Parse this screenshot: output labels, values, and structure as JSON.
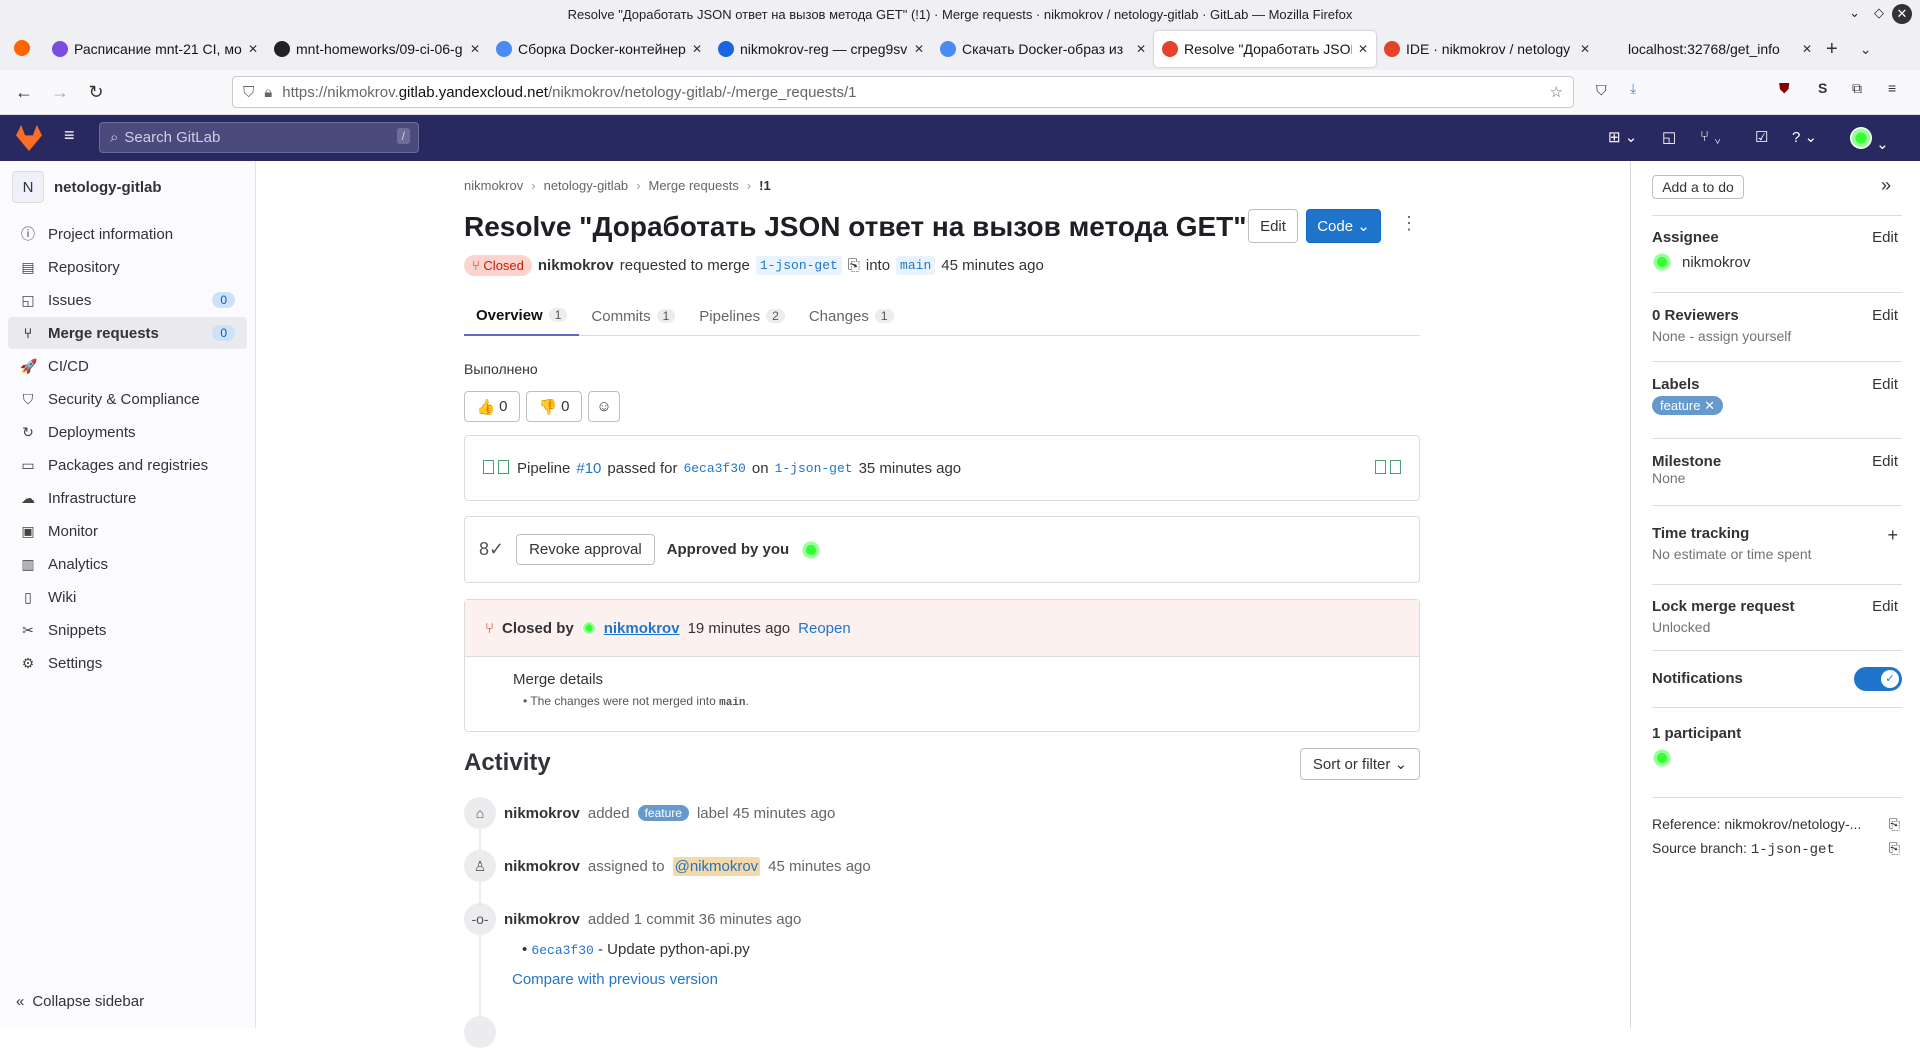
{
  "window_title": "Resolve \"Доработать JSON ответ на вызов метода GET\" (!1) · Merge requests · nikmokrov / netology-gitlab · GitLab — Mozilla Firefox",
  "tabs": [
    {
      "label": "Расписание mnt-21 CI, мо",
      "color": "#7b4ce0"
    },
    {
      "label": "mnt-homeworks/09-ci-06-g",
      "color": "#222"
    },
    {
      "label": "Сборка Docker-контейнер",
      "color": "#4a8af4"
    },
    {
      "label": "nikmokrov-reg — crpeg9sv",
      "color": "#1a66e0"
    },
    {
      "label": "Скачать Docker-образ из",
      "color": "#4a8af4"
    },
    {
      "label": "Resolve \"Доработать JSON",
      "color": "#e24329"
    },
    {
      "label": "IDE · nikmokrov / netology",
      "color": "#e24329"
    },
    {
      "label": "localhost:32768/get_info",
      "color": "#f0f0f4"
    }
  ],
  "url": {
    "prefix": "https://nikmokrov.",
    "domain": "gitlab.yandexcloud.net",
    "path": "/nikmokrov/netology-gitlab/-/merge_requests/1"
  },
  "search": {
    "placeholder": "Search GitLab",
    "shortcut": "/"
  },
  "sidebar": {
    "project_initial": "N",
    "project": "netology-gitlab",
    "items": [
      {
        "label": "Project information",
        "icon": "ⓘ"
      },
      {
        "label": "Repository",
        "icon": "▤"
      },
      {
        "label": "Issues",
        "icon": "◱",
        "count": "0"
      },
      {
        "label": "Merge requests",
        "icon": "⑂",
        "count": "0"
      },
      {
        "label": "CI/CD",
        "icon": "🚀"
      },
      {
        "label": "Security & Compliance",
        "icon": "⛉"
      },
      {
        "label": "Deployments",
        "icon": "↻"
      },
      {
        "label": "Packages and registries",
        "icon": "▭"
      },
      {
        "label": "Infrastructure",
        "icon": "☁"
      },
      {
        "label": "Monitor",
        "icon": "▣"
      },
      {
        "label": "Analytics",
        "icon": "▥"
      },
      {
        "label": "Wiki",
        "icon": "▯"
      },
      {
        "label": "Snippets",
        "icon": "✂"
      },
      {
        "label": "Settings",
        "icon": "⚙"
      }
    ],
    "collapse": "Collapse sidebar"
  },
  "breadcrumb": [
    "nikmokrov",
    "netology-gitlab",
    "Merge requests",
    "!1"
  ],
  "mr": {
    "title": "Resolve \"Доработать JSON ответ на вызов метода GET\"",
    "edit": "Edit",
    "code": "Code",
    "status": "Closed",
    "author": "nikmokrov",
    "requested": "requested to merge",
    "source": "1-json-get",
    "into": "into",
    "target": "main",
    "time": "45 minutes ago"
  },
  "mr_tabs": [
    {
      "label": "Overview",
      "count": "1"
    },
    {
      "label": "Commits",
      "count": "1"
    },
    {
      "label": "Pipelines",
      "count": "2"
    },
    {
      "label": "Changes",
      "count": "1"
    }
  ],
  "description": "Выполнено",
  "reactions": {
    "up": "0",
    "down": "0"
  },
  "pipeline": {
    "label": "Pipeline",
    "id": "#10",
    "passed": "passed for",
    "sha": "6eca3f30",
    "on": "on",
    "branch": "1-json-get",
    "time": "35 minutes ago"
  },
  "approval": {
    "revoke": "Revoke approval",
    "approved": "Approved by you"
  },
  "closed": {
    "label": "Closed by",
    "user": "nikmokrov",
    "time": "19 minutes ago",
    "reopen": "Reopen",
    "details_title": "Merge details",
    "details_text": "The changes were not merged into",
    "details_branch": "main"
  },
  "activity": {
    "title": "Activity",
    "sort": "Sort or filter",
    "items": [
      {
        "user": "nikmokrov",
        "text": "added",
        "label": "feature",
        "after": "label 45 minutes ago"
      },
      {
        "user": "nikmokrov",
        "text": "assigned to",
        "mention": "@nikmokrov",
        "after": "45 minutes ago"
      },
      {
        "user": "nikmokrov",
        "text": "added 1 commit 36 minutes ago",
        "commit_sha": "6eca3f30",
        "commit_msg": "- Update python-api.py",
        "compare": "Compare with previous version"
      }
    ]
  },
  "right": {
    "todo": "Add a to do",
    "assignee_h": "Assignee",
    "assignee": "nikmokrov",
    "edit": "Edit",
    "reviewers_h": "0 Reviewers",
    "reviewers": "None - assign yourself",
    "labels_h": "Labels",
    "label": "feature",
    "milestone_h": "Milestone",
    "milestone": "None",
    "time_h": "Time tracking",
    "time": "No estimate or time spent",
    "lock_h": "Lock merge request",
    "lock": "Unlocked",
    "notif_h": "Notifications",
    "notifications_on": true,
    "participants_h": "1 participant",
    "reference": "Reference: nikmokrov/netology-...",
    "source_label": "Source branch:",
    "source": "1-json-get"
  }
}
